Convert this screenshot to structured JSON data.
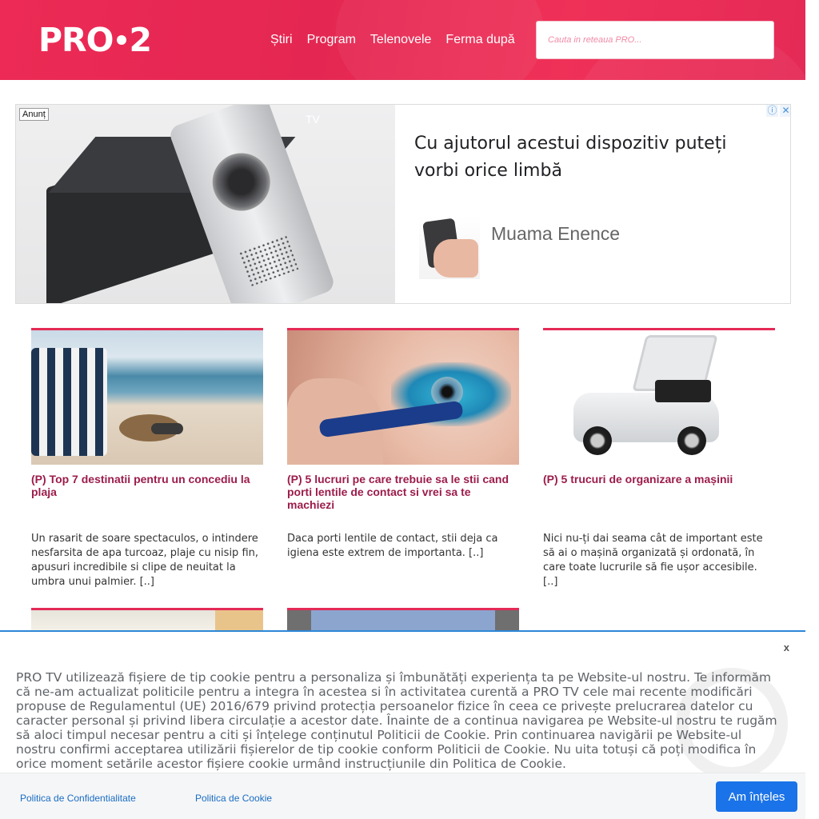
{
  "header": {
    "logo_text": "PRO",
    "logo_number": "2",
    "nav": [
      "Știri",
      "Program",
      "Telenovele",
      "Ferma după"
    ],
    "search_placeholder": "Cauta in reteaua PRO..."
  },
  "ad": {
    "badge": "Anunț",
    "tv_label": "TV",
    "title": "Cu ajutorul acestui dispozitiv puteți vorbi orice limbă",
    "brand": "Muama Enence",
    "icons": [
      "info-icon",
      "close-icon"
    ]
  },
  "articles": [
    {
      "title": "(P) Top 7 destinatii pentru un concediu la plaja",
      "excerpt": "Un rasarit de soare spectaculos, o intindere nesfarsita de apa turcoaz, plaje cu nisip fin, apusuri incredibile si clipe de neuitat la umbra unui palmier. [..]"
    },
    {
      "title": "(P) 5 lucruri pe care trebuie sa le stii cand porti lentile de contact si vrei sa te machiezi",
      "excerpt": "Daca porti lentile de contact, stii deja ca igiena este extrem de importanta. [..]"
    },
    {
      "title": "(P) 5 trucuri de organizare a mașinii",
      "excerpt": "Nici nu-ți dai seama cât de important este să ai o mașină organizată și ordonată, în care toate lucrurile să fie ușor accesibile.  [..]"
    }
  ],
  "cookie": {
    "close": "x",
    "text": "PRO TV utilizează fișiere de tip cookie pentru a personaliza și îmbunătăți experiența ta pe Website-ul nostru. Te informăm că ne-am actualizat politicile pentru a integra în acestea si în activitatea curentă a PRO TV cele mai recente modificări propuse de Regulamentul (UE) 2016/679 privind protecția persoanelor fizice în ceea ce privește prelucrarea datelor cu caracter personal și privind libera circulație a acestor date. Înainte de a continua navigarea pe Website-ul nostru te rugăm să aloci timpul necesar pentru a citi și înțelege conținutul Politicii de Cookie. Prin continuarea navigării pe Website-ul nostru confirmi acceptarea utilizării fișierelor de tip cookie conform Politicii de Cookie. Nu uita totuși că poți modifica în orice moment setările acestor fișiere cookie urmând instrucțiunile din Politica de Cookie.",
    "privacy_link": "Politica de Confidentialitate",
    "cookie_link": "Politica de Cookie",
    "accept": "Am înțeles"
  },
  "colors": {
    "brand": "#e42a56",
    "article_title": "#9c1c4a",
    "accept_button": "#1a73e8"
  }
}
